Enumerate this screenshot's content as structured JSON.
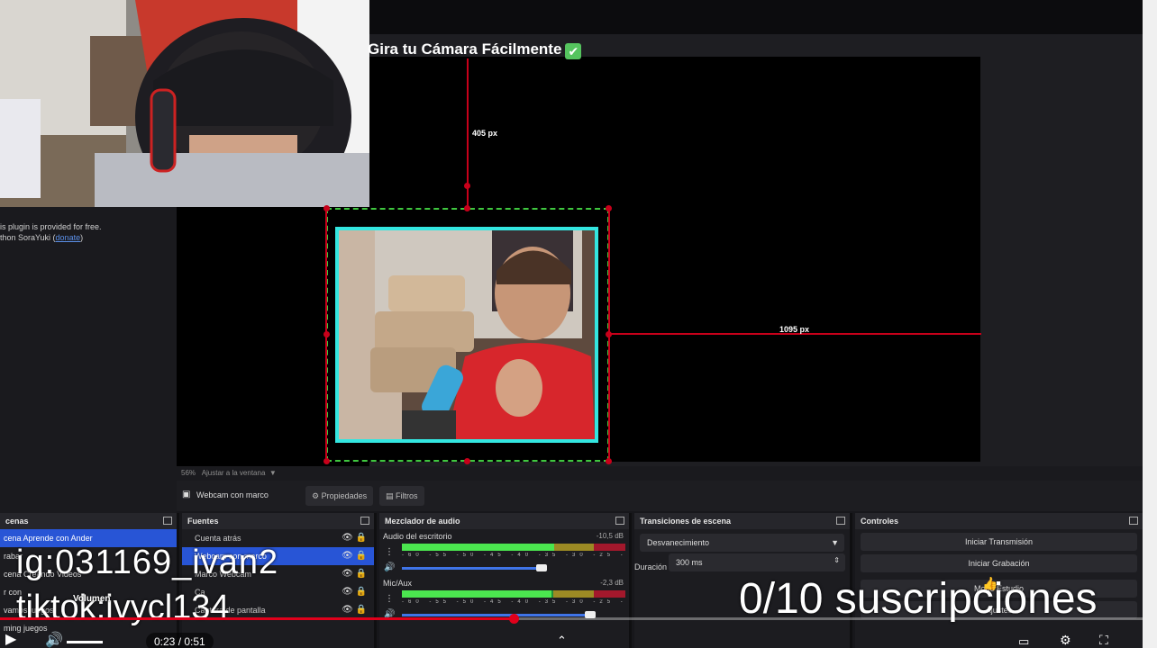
{
  "overlay": {
    "title": "Gira tu Cámara Fácilmente",
    "check": "✔",
    "instagram": "ig:031169_ivan2",
    "tiktok": "tiktok:ivycl134",
    "subs_counter": "0/10 suscripciones"
  },
  "plugin_info": {
    "line1": "is plugin is provided for free.",
    "line2_prefix": "thon SoraYuki (",
    "line2_link": "donate",
    "line2_suffix": ")"
  },
  "preview": {
    "measure_top": "405 px",
    "measure_right": "1095 px"
  },
  "zoom_bar": {
    "zoom": "56%",
    "fit_label": "Ajustar a la ventana"
  },
  "source_toolbar": {
    "selected_source": "Webcam con marco",
    "properties": "Propiedades",
    "filters": "Filtros"
  },
  "scenes": {
    "title": "cenas",
    "items": [
      "cena Aprende con Ander",
      "rabar",
      "cena Creando Videos",
      "r con",
      "vamos juegos",
      "ming juegos"
    ]
  },
  "sources": {
    "title": "Fuentes",
    "items": [
      "Cuenta atrás",
      "Webcam con marco",
      "Marco Webcam",
      "Ca",
      "Captura de pantalla"
    ]
  },
  "mixer": {
    "title": "Mezclador de audio",
    "channels": [
      {
        "name": "Audio del escritorio",
        "db": "-10,5 dB",
        "level": 0.68
      },
      {
        "name": "Mic/Aux",
        "db": "-2,3 dB",
        "level": 0.67
      }
    ],
    "ticks": "-60 -55 -50 -45 -40 -35 -30 -25 -20 -15 -10 -5 0"
  },
  "transitions": {
    "title": "Transiciones de escena",
    "type": "Desvanecimiento",
    "duration_label": "Duración",
    "duration_value": "300 ms"
  },
  "controls": {
    "title": "Controles",
    "start_stream": "Iniciar Transmisión",
    "start_record": "Iniciar Grabación",
    "studio_mode": "Modo Estudio",
    "settings": "Ajustes"
  },
  "player": {
    "time": "0:23 / 0:51",
    "progress": 0.45,
    "volume_label": "Volumen"
  },
  "colors": {
    "accent_blue": "#2855d6",
    "guide_red": "#c8001a",
    "frame_cyan": "#33e6e0",
    "selection_green": "#3fc73f",
    "yt_red": "#e0001b"
  }
}
